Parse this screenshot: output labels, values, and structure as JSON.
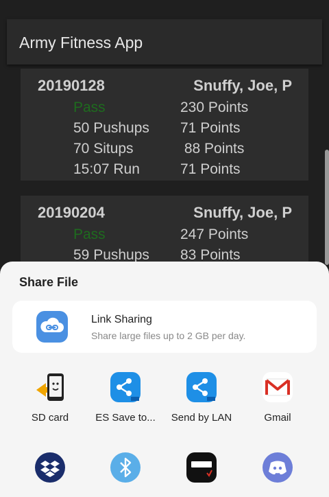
{
  "app": {
    "title": "Army Fitness App"
  },
  "records": [
    {
      "date": "20190128",
      "name": "Snuffy, Joe, P",
      "result": "Pass",
      "total": "230 Points",
      "pushups": "50 Pushups",
      "pushups_points": "71 Points",
      "situps": "70 Situps",
      "situps_points": " 88 Points",
      "run": "15:07 Run",
      "run_points": "71 Points"
    },
    {
      "date": "20190204",
      "name": "Snuffy, Joe, P",
      "result": "Pass",
      "total": "247 Points",
      "pushups": "59 Pushups",
      "pushups_points": "83 Points"
    }
  ],
  "share": {
    "title": "Share File",
    "link_sharing": {
      "title": "Link Sharing",
      "subtitle": "Share large files up to 2 GB per day."
    },
    "apps": [
      {
        "label": "SD card",
        "icon": "sd-card-icon"
      },
      {
        "label": "ES Save to...",
        "icon": "es-save-icon"
      },
      {
        "label": "Send by LAN",
        "icon": "send-lan-icon"
      },
      {
        "label": "Gmail",
        "icon": "gmail-icon"
      },
      {
        "label": "",
        "icon": "dropbox-icon"
      },
      {
        "label": "",
        "icon": "bluetooth-icon"
      },
      {
        "label": "",
        "icon": "cloud-icon"
      },
      {
        "label": "",
        "icon": "discord-icon"
      }
    ]
  },
  "colors": {
    "pass": "#1e6b1e",
    "link_icon": "#4a90e2",
    "es_blue": "#1e8fe6",
    "gmail_red": "#d93025",
    "dropbox_navy": "#1a2d6b",
    "bluetooth_blue": "#5aaee8",
    "discord_purple": "#6d7ed8"
  }
}
